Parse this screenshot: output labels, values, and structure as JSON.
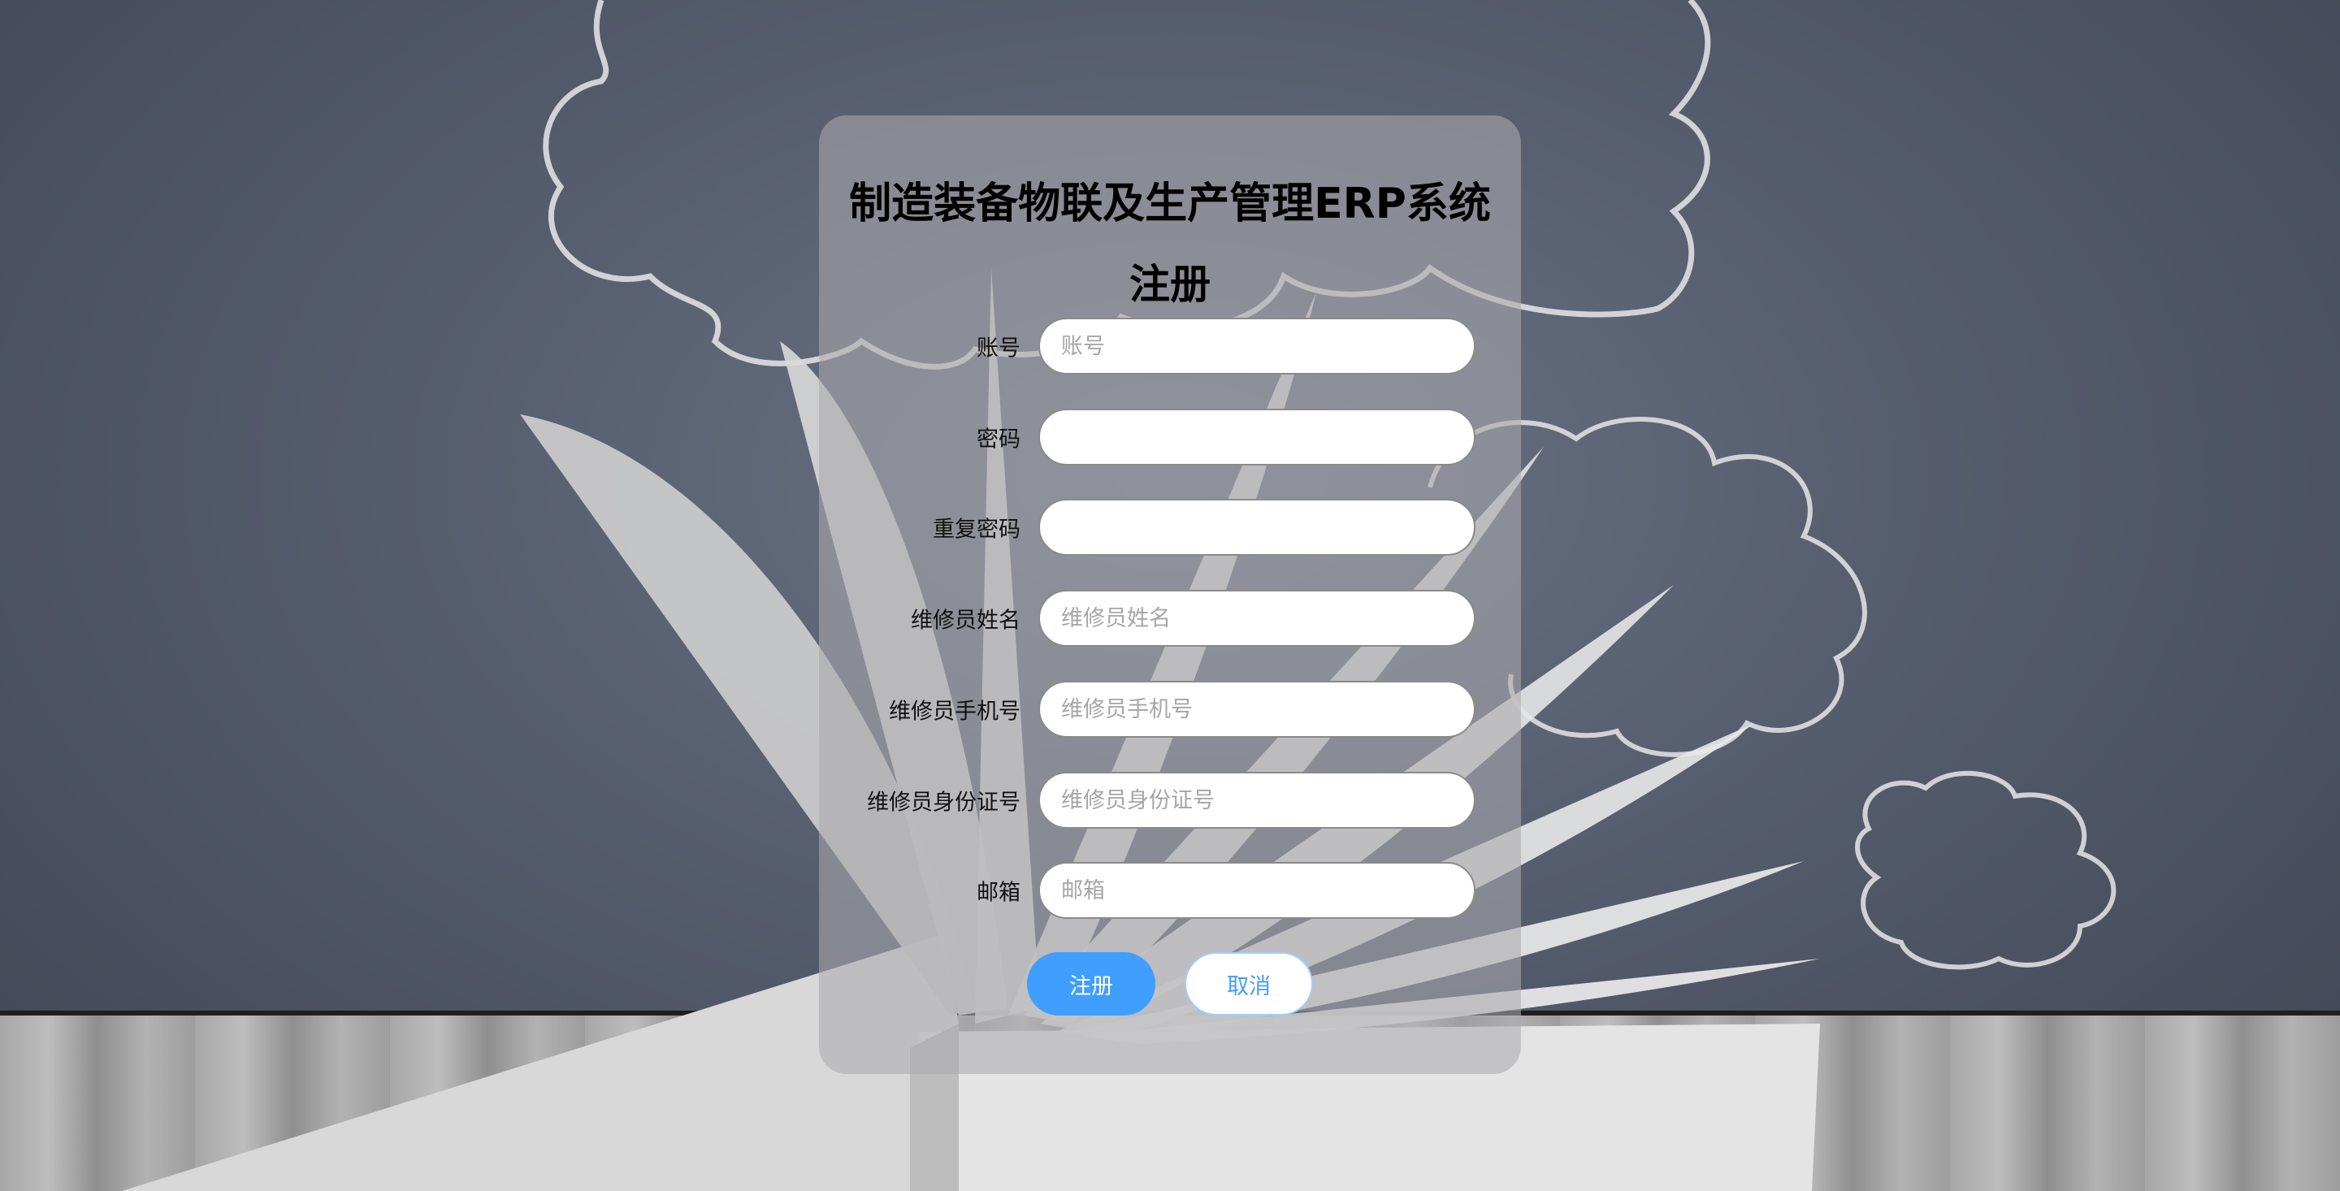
{
  "page": {
    "title": "制造装备物联及生产管理ERP系统",
    "subtitle": "注册"
  },
  "form": {
    "fields": [
      {
        "label": "账号",
        "placeholder": "账号",
        "type": "text"
      },
      {
        "label": "密码",
        "placeholder": "",
        "type": "password"
      },
      {
        "label": "重复密码",
        "placeholder": "",
        "type": "password"
      },
      {
        "label": "维修员姓名",
        "placeholder": "维修员姓名",
        "type": "text"
      },
      {
        "label": "维修员手机号",
        "placeholder": "维修员手机号",
        "type": "text"
      },
      {
        "label": "维修员身份证号",
        "placeholder": "维修员身份证号",
        "type": "text"
      },
      {
        "label": "邮箱",
        "placeholder": "邮箱",
        "type": "text"
      }
    ],
    "submit_label": "注册",
    "cancel_label": "取消"
  },
  "colors": {
    "primary": "#409eff",
    "card": "#aaa8ac"
  }
}
